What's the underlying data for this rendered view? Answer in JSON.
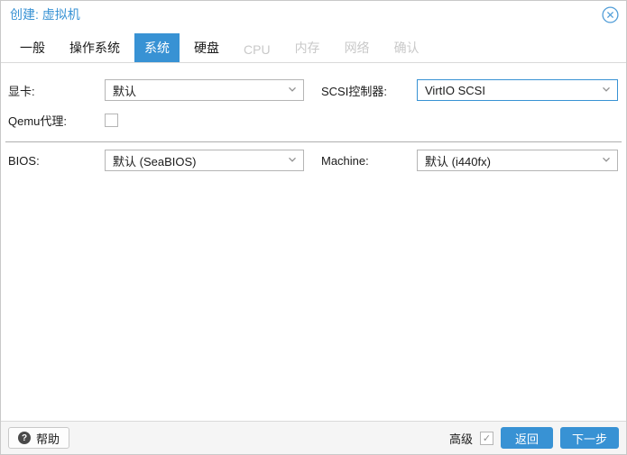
{
  "colors": {
    "accent": "#3892d4",
    "field_border": "#b5b5b5",
    "disabled_tab_text": "#c9c9c9",
    "footer_bg": "#f5f5f5"
  },
  "dialog": {
    "title": "创建: 虚拟机"
  },
  "icons": {
    "close": "circle-x",
    "help": "?",
    "chevron": "chevron-down",
    "check": "✓"
  },
  "tabs": [
    {
      "label": "一般",
      "state": "normal"
    },
    {
      "label": "操作系统",
      "state": "normal"
    },
    {
      "label": "系统",
      "state": "active"
    },
    {
      "label": "硬盘",
      "state": "normal"
    },
    {
      "label": "CPU",
      "state": "disabled"
    },
    {
      "label": "内存",
      "state": "disabled"
    },
    {
      "label": "网络",
      "state": "disabled"
    },
    {
      "label": "确认",
      "state": "disabled"
    }
  ],
  "form": {
    "gpu": {
      "label": "显卡:",
      "value": "默认"
    },
    "scsi": {
      "label": "SCSI控制器:",
      "value": "VirtIO SCSI"
    },
    "qemu_agent": {
      "label": "Qemu代理:",
      "checked": false
    },
    "bios": {
      "label": "BIOS:",
      "value": "默认 (SeaBIOS)"
    },
    "machine": {
      "label": "Machine:",
      "value": "默认 (i440fx)"
    }
  },
  "footer": {
    "help": "帮助",
    "advanced": "高级",
    "advanced_checked": true,
    "back": "返回",
    "next": "下一步"
  }
}
